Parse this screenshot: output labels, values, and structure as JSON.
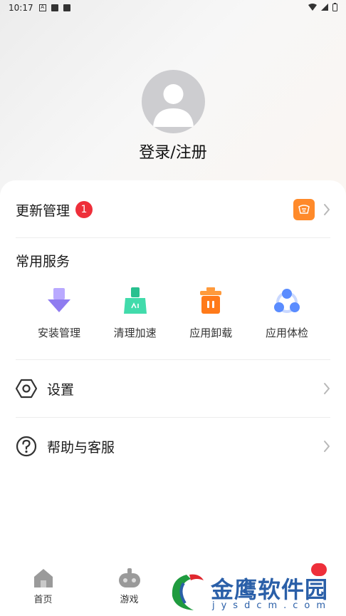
{
  "status_bar": {
    "time": "10:17"
  },
  "profile": {
    "login_label": "登录/注册"
  },
  "update_row": {
    "title": "更新管理",
    "badge_count": "1"
  },
  "services": {
    "title": "常用服务",
    "items": [
      {
        "label": "安装管理",
        "icon": "install-download-icon",
        "color": "#8f7cf0"
      },
      {
        "label": "清理加速",
        "icon": "broom-clean-icon",
        "color": "#2fd1a0"
      },
      {
        "label": "应用卸载",
        "icon": "trash-uninstall-icon",
        "color": "#ff7a1a"
      },
      {
        "label": "应用体检",
        "icon": "checkup-nodes-icon",
        "color": "#5a8cff"
      }
    ]
  },
  "menu": {
    "settings_label": "设置",
    "help_label": "帮助与客服"
  },
  "tabs": [
    {
      "label": "首页",
      "icon": "home-icon"
    },
    {
      "label": "游戏",
      "icon": "gamepad-icon"
    }
  ],
  "watermark": {
    "title": "金鹰软件园",
    "subtitle": "jysdcm.com"
  },
  "colors": {
    "badge": "#ee2f3a",
    "text": "#1a1a1a",
    "divider": "#ececec"
  }
}
